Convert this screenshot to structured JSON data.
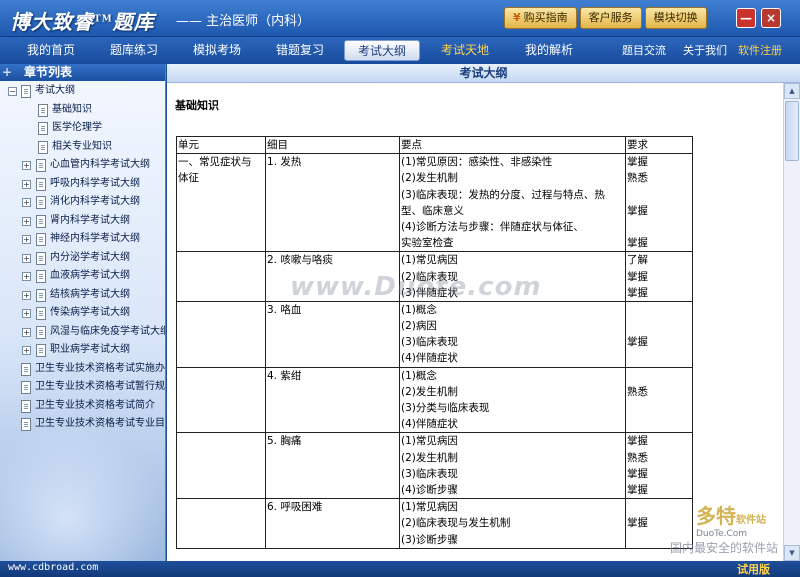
{
  "app": {
    "logo": "博大致睿",
    "logo_tm": "TM",
    "logo_suffix": "题库",
    "subtitle": "—— 主治医师（内科）"
  },
  "top_buttons": [
    {
      "label": "购买指南",
      "icon": "cart-icon"
    },
    {
      "label": "客户服务"
    },
    {
      "label": "模块切换"
    }
  ],
  "window_controls": {
    "minimize": "—",
    "close": "×"
  },
  "nav": {
    "tabs": [
      "我的首页",
      "题库练习",
      "模拟考场",
      "错题复习",
      "考试大纲",
      "考试天地",
      "我的解析"
    ],
    "links": [
      "题目交流",
      "关于我们",
      "软件注册"
    ]
  },
  "sidebar": {
    "title": "章节列表",
    "items": [
      {
        "label": "考试大纲",
        "level": 0,
        "expander": "−"
      },
      {
        "label": "基础知识",
        "level": 1,
        "expander": ""
      },
      {
        "label": "医学伦理学",
        "level": 1,
        "expander": ""
      },
      {
        "label": "相关专业知识",
        "level": 1,
        "expander": ""
      },
      {
        "label": "心血管内科学考试大纲",
        "level": 1,
        "expander": "+"
      },
      {
        "label": "呼吸内科学考试大纲",
        "level": 1,
        "expander": "+"
      },
      {
        "label": "消化内科学考试大纲",
        "level": 1,
        "expander": "+"
      },
      {
        "label": "肾内科学考试大纲",
        "level": 1,
        "expander": "+"
      },
      {
        "label": "神经内科学考试大纲",
        "level": 1,
        "expander": "+"
      },
      {
        "label": "内分泌学考试大纲",
        "level": 1,
        "expander": "+"
      },
      {
        "label": "血液病学考试大纲",
        "level": 1,
        "expander": "+"
      },
      {
        "label": "结核病学考试大纲",
        "level": 1,
        "expander": "+"
      },
      {
        "label": "传染病学考试大纲",
        "level": 1,
        "expander": "+"
      },
      {
        "label": "风湿与临床免疫学考试大纲",
        "level": 1,
        "expander": "+"
      },
      {
        "label": "职业病学考试大纲",
        "level": 1,
        "expander": "+"
      },
      {
        "label": "卫生专业技术资格考试实施办法",
        "level": 0,
        "expander": ""
      },
      {
        "label": "卫生专业技术资格考试暂行规定",
        "level": 0,
        "expander": ""
      },
      {
        "label": "卫生专业技术资格考试简介",
        "level": 0,
        "expander": ""
      },
      {
        "label": "卫生专业技术资格考试专业目录",
        "level": 0,
        "expander": ""
      }
    ]
  },
  "content": {
    "header": "考试大纲",
    "section_title": "基础知识",
    "table": {
      "headers": [
        "单元",
        "细目",
        "要点",
        "要求"
      ],
      "rows": [
        {
          "unit": [
            "一、常见症状与",
            "体征"
          ],
          "item": "1. 发热",
          "points": [
            "(1)常见原因：感染性、非感染性",
            "(2)发生机制",
            "(3)临床表现：发热的分度、过程与特点、热",
            "型、临床意义",
            "(4)诊断方法与步骤：伴随症状与体征、",
            "实验室检查"
          ],
          "reqs": [
            "掌握",
            "熟悉",
            "",
            "掌握",
            "",
            "掌握"
          ]
        },
        {
          "unit": [],
          "item": "2. 咳嗽与咯痰",
          "points": [
            "(1)常见病因",
            "(2)临床表现",
            "(3)伴随症状"
          ],
          "reqs": [
            "了解",
            "掌握",
            "掌握"
          ]
        },
        {
          "unit": [],
          "item": "3. 咯血",
          "points": [
            "(1)概念",
            "(2)病因",
            "(3)临床表现",
            "(4)伴随症状"
          ],
          "reqs": [
            "",
            "",
            "掌握",
            ""
          ]
        },
        {
          "unit": [],
          "item": "4. 紫绀",
          "points": [
            "(1)概念",
            "(2)发生机制",
            "(3)分类与临床表现",
            "(4)伴随症状"
          ],
          "reqs": [
            "",
            "熟悉",
            "",
            ""
          ]
        },
        {
          "unit": [],
          "item": "5. 胸痛",
          "points": [
            "(1)常见病因",
            "(2)发生机制",
            "(3)临床表现",
            "(4)诊断步骤"
          ],
          "reqs": [
            "掌握",
            "熟悉",
            "掌握",
            "掌握"
          ]
        },
        {
          "unit": [],
          "item": "6. 呼吸困难",
          "points": [
            "(1)常见病因",
            "(2)临床表现与发生机制",
            "(3)诊断步骤"
          ],
          "reqs": [
            "",
            "掌握",
            ""
          ]
        }
      ]
    }
  },
  "status": {
    "url": "www.cdbroad.com",
    "trial": "试用版"
  },
  "watermark": {
    "main": "www.Duote.com",
    "brand": "多特",
    "brand_suffix": "软件站",
    "domain": "DuoTe.Com",
    "slogan": "国内最安全的软件站"
  }
}
